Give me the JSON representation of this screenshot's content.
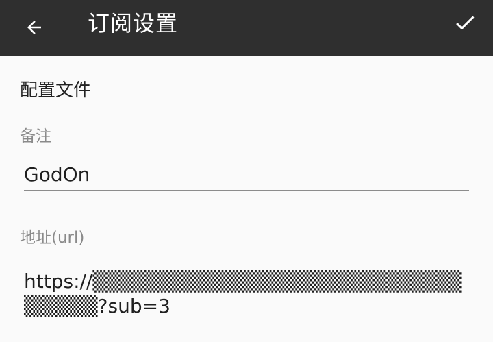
{
  "header": {
    "title": "订阅设置",
    "back_icon": "arrow-left-icon",
    "confirm_icon": "check-icon",
    "background_color": "#2f2f2f",
    "text_color": "#ffffff"
  },
  "form": {
    "section_title": "配置文件",
    "remark": {
      "label": "备注",
      "value": "GodOn"
    },
    "url": {
      "label": "地址(url)",
      "value": "https://▒▒▒▒▒▒▒▒▒▒▒▒▒▒▒▒▒▒▒▒▒▒▒▒▒▒▒▒▒▒?sub=3"
    }
  }
}
